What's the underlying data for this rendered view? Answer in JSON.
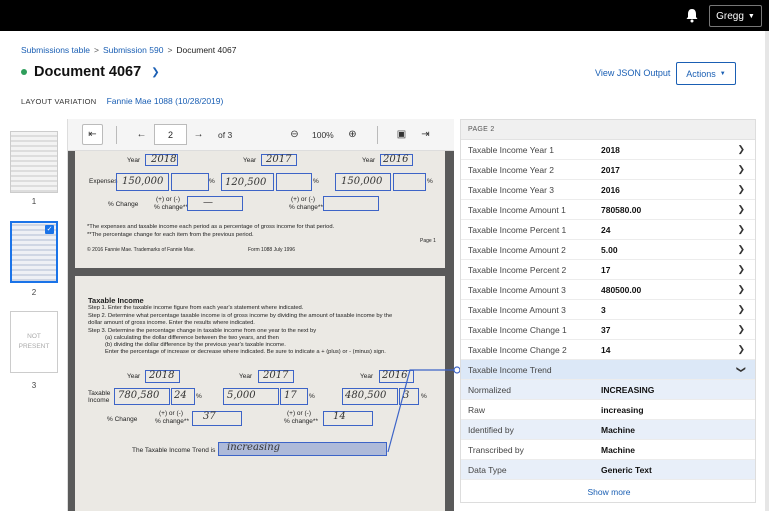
{
  "topbar": {
    "user_name": "Gregg"
  },
  "breadcrumb": {
    "item1": "Submissions table",
    "item2": "Submission 590",
    "current": "Document 4067",
    "sep": ">"
  },
  "header": {
    "title": "Document 4067",
    "view_json": "View JSON Output",
    "actions": "Actions",
    "layout_label": "LAYOUT VARIATION",
    "layout_value": "Fannie Mae 1088 (10/28/2019)"
  },
  "thumbnails": {
    "items": [
      {
        "number": "1"
      },
      {
        "number": "2",
        "selected": true
      },
      {
        "number": "3",
        "not_present": "NOT PRESENT"
      }
    ]
  },
  "toolbar": {
    "page": "2",
    "of": "of 3",
    "zoom": "100%"
  },
  "document": {
    "p1": {
      "year": "Year",
      "y1": "2018",
      "y2": "2017",
      "y3": "2016",
      "expenses": "Expenses",
      "e1": "150,000",
      "e2": "120,500",
      "e3": "150,000",
      "pct": "%",
      "pct_change": "% Change",
      "plus_minus": "(+) or (-)",
      "pct_change2": "% change**",
      "note1": "*The expenses and taxable income each period as a percentage of gross income for that period.",
      "note2": "**The percentage change for each item from the previous period.",
      "copyright": "© 2016 Fannie Mae. Trademarks of Fannie Mae.",
      "form": "Form 1088  July 1996",
      "page": "Page 1"
    },
    "p2": {
      "heading": "Taxable Income",
      "step1": "Step 1. Enter the taxable income figure from each year's statement where indicated.",
      "step2": "Step 2. Determine what percentage taxable income is of gross income by dividing the amount of taxable income by the",
      "step2b": "dollar amount of gross income. Enter the results where indicated.",
      "step3": "Step 3. Determine the percentage change in taxable income from one year to the next by",
      "step3a": "(a) calculating the dollar difference between the two years, and then",
      "step3b": "(b) dividing the dollar difference by the previous year's taxable income.",
      "step3c": "Enter the percentage of increase or decrease where indicated. Be sure to indicate a + (plus) or - (minus) sign.",
      "year": "Year",
      "y1": "2018",
      "y2": "2017",
      "y3": "2016",
      "taxable": "Taxable",
      "income": "Income",
      "t1": "780,580",
      "tp1": "24",
      "t2": "5,000",
      "tp2": "17",
      "t3": "480,500",
      "tp3": "3",
      "pct": "%",
      "pct_change": "% Change",
      "plus_minus": "(+) or (-)",
      "pct_change2": "% change**",
      "c1": "37",
      "c2": "14",
      "trend_label": "The Taxable Income Trend is",
      "trend_value": "increasing"
    }
  },
  "panel": {
    "page_label": "PAGE 2",
    "rows": [
      {
        "label": "Taxable Income Year 1",
        "value": "2018"
      },
      {
        "label": "Taxable Income Year 2",
        "value": "2017"
      },
      {
        "label": "Taxable Income Year 3",
        "value": "2016"
      },
      {
        "label": "Taxable Income Amount 1",
        "value": "780580.00"
      },
      {
        "label": "Taxable Income Percent 1",
        "value": "24"
      },
      {
        "label": "Taxable Income Amount 2",
        "value": "5.00"
      },
      {
        "label": "Taxable Income Percent 2",
        "value": "17"
      },
      {
        "label": "Taxable Income Amount 3",
        "value": "480500.00"
      },
      {
        "label": "Taxable Income Amount 3",
        "value": "3"
      },
      {
        "label": "Taxable Income Change 1",
        "value": "37"
      },
      {
        "label": "Taxable Income Change 2",
        "value": "14"
      }
    ],
    "expanded": {
      "label": "Taxable Income Trend",
      "details": [
        {
          "label": "Normalized",
          "value": "INCREASING"
        },
        {
          "label": "Raw",
          "value": "increasing"
        },
        {
          "label": "Identified by",
          "value": "Machine"
        },
        {
          "label": "Transcribed by",
          "value": "Machine"
        },
        {
          "label": "Data Type",
          "value": "Generic Text"
        }
      ]
    },
    "show_more": "Show more"
  },
  "colors": {
    "link": "#1a5fb4",
    "highlight": "#3d64c7",
    "status": "#2e9e5b"
  },
  "icons": [
    "bell-icon",
    "chevron-down-icon",
    "sidebar-toggle-icon",
    "arrow-left-icon",
    "arrow-right-icon",
    "zoom-out-icon",
    "zoom-in-icon",
    "image-icon",
    "list-icon",
    "chevron-right-icon",
    "check-icon"
  ]
}
